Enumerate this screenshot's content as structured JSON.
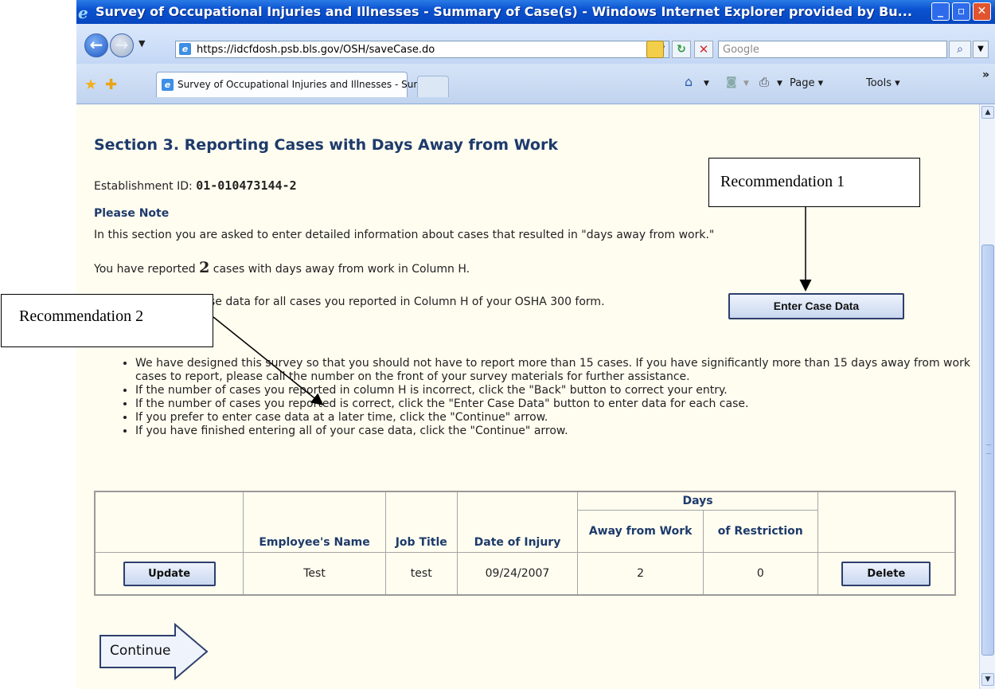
{
  "window": {
    "title": "Survey of Occupational Injuries and Illnesses - Summary of Case(s) - Windows Internet Explorer provided by Bu...",
    "minimize": "_",
    "maximize": "▫",
    "close": "✕"
  },
  "toolbar": {
    "back": "←",
    "forward": "→",
    "url": "https://idcfdosh.psb.bls.gov/OSH/saveCase.do",
    "search_placeholder": "Google",
    "search_button": "⌕",
    "refresh": "↻",
    "stop": "✕"
  },
  "tabs": {
    "active_tab": "Survey of Occupational Injuries and Illnesses - Summ...",
    "page_menu": "Page ▾",
    "tools_menu": "Tools ▾",
    "home": "⌂",
    "feeds": "◙",
    "print": "⎙",
    "more": "»"
  },
  "page": {
    "section_title": "Section 3. Reporting Cases with Days Away from Work",
    "establishment_label": "Establishment ID: ",
    "establishment_id": "01-010473144-2",
    "note_heading": "Please Note",
    "note_text": "In this section you are asked to enter detailed information about cases that resulted in \"days away from work.\"",
    "reported_prefix": "You have reported ",
    "reported_count": "2",
    "reported_suffix": " cases with days away from work in Column H.",
    "enter_instruction": "se data for all cases you reported in Column H of your OSHA 300 form.",
    "enter_case_button": "Enter Case Data",
    "bullets": [
      "We have designed this survey so that you should not have to report more than 15 cases. If you have significantly more than 15 days away from work cases to report, please call the number on the front of your survey materials for further assistance.",
      "If the number of cases you reported in column H is incorrect, click the \"Back\" button to correct your entry.",
      "If the number of cases you reported is correct, click the \"Enter Case Data\" button to enter data for each case.",
      "If you prefer to enter case data at a later time, click the \"Continue\" arrow.",
      "If you have finished entering all of your case data, click the \"Continue\" arrow."
    ],
    "continue_label": "Continue"
  },
  "table": {
    "days_group": "Days",
    "headers": {
      "employee": "Employee's Name",
      "job": "Job Title",
      "date": "Date of Injury",
      "away": "Away from Work",
      "restriction": "of Restriction"
    },
    "rows": [
      {
        "update": "Update",
        "employee": "Test",
        "job": "test",
        "date": "09/24/2007",
        "away": "2",
        "restriction": "0",
        "delete": "Delete"
      }
    ]
  },
  "annotations": {
    "rec1": "Recommendation 1",
    "rec2": "Recommendation 2"
  },
  "colors": {
    "titlebar": "#0a52d0",
    "page_background": "#fffdf0",
    "heading": "#1d3a6b",
    "button_border": "#2d3f6c"
  }
}
